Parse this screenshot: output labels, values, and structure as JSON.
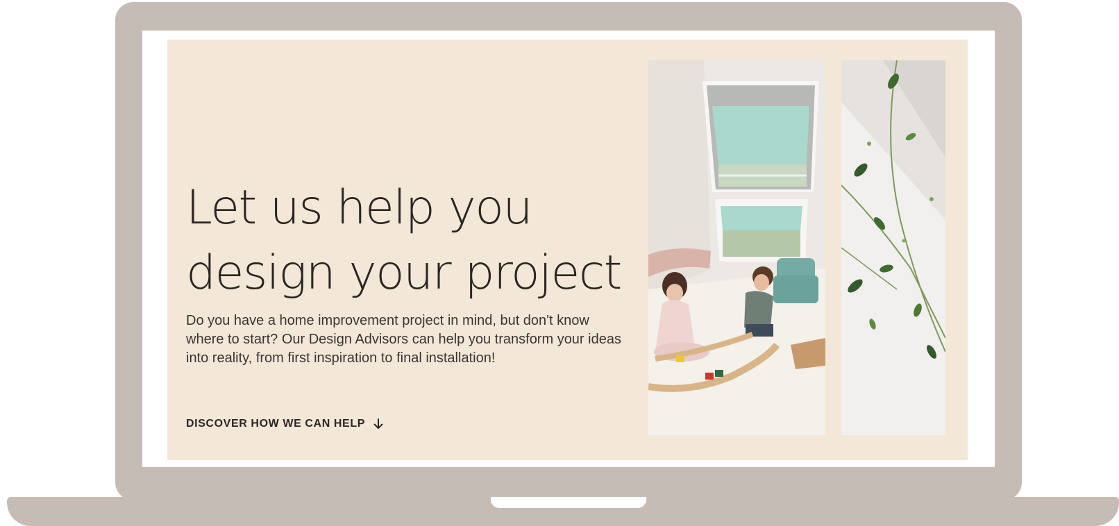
{
  "hero": {
    "headline_line1": "Let us help you",
    "headline_line2": "design your project",
    "body": "Do you have a home improvement project in mind, but don't know where to start? Our Design Advisors can help you transform your ideas into reality, from first inspiration to final installation!",
    "cta_label": "DISCOVER HOW WE CAN HELP",
    "cta_icon": "arrow-down-icon"
  },
  "images": {
    "kids_photo": "children-playing-under-roof-windows-photo",
    "plant_photo": "green-plant-stems-photo"
  },
  "colors": {
    "laptop_frame": "#c5bdb5",
    "banner_background": "#f3e8d8",
    "text": "#2b2522",
    "blind": "#a9d8cc"
  }
}
